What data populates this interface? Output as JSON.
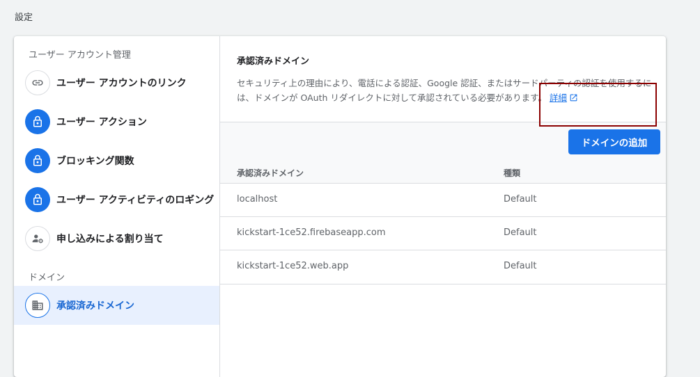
{
  "page": {
    "title": "設定"
  },
  "sidebar": {
    "sections": [
      {
        "label": "ユーザー アカウント管理"
      },
      {
        "label": "ドメイン"
      }
    ],
    "items": [
      {
        "label": "ユーザー アカウントのリンク",
        "icon": "link-icon"
      },
      {
        "label": "ユーザー アクション",
        "icon": "lock-icon"
      },
      {
        "label": "ブロッキング関数",
        "icon": "lock-icon"
      },
      {
        "label": "ユーザー アクティビティのロギング",
        "icon": "lock-icon"
      },
      {
        "label": "申し込みによる割り当て",
        "icon": "user-settings-icon"
      },
      {
        "label": "承認済みドメイン",
        "icon": "building-icon",
        "selected": true
      }
    ]
  },
  "main": {
    "title": "承認済みドメイン",
    "description": "セキュリティ上の理由により、電話による認証、Google 認証、またはサードパーティの認証を使用するには、ドメインが OAuth リダイレクトに対して承認されている必要があります。",
    "learn_more": "詳細",
    "add_button": "ドメインの追加",
    "table": {
      "headers": [
        "承認済みドメイン",
        "種類"
      ],
      "rows": [
        [
          "localhost",
          "Default"
        ],
        [
          "kickstart-1ce52.firebaseapp.com",
          "Default"
        ],
        [
          "kickstart-1ce52.web.app",
          "Default"
        ]
      ]
    }
  },
  "colors": {
    "accent": "#1a73e8",
    "selected_bg": "#e8f0fe",
    "highlight_border": "#8b0000"
  }
}
